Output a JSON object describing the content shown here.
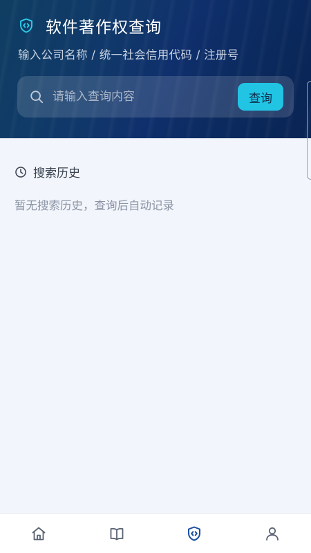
{
  "header": {
    "title": "软件著作权查询",
    "subtitle": "输入公司名称 / 统一社会信用代码 / 注册号",
    "logo_icon": "shield-code-icon"
  },
  "search": {
    "placeholder": "请输入查询内容",
    "value": "",
    "button_label": "查询"
  },
  "history": {
    "title": "搜索历史",
    "empty_text": "暂无搜索历史，查询后自动记录"
  },
  "tabbar": {
    "items": [
      {
        "icon": "home-icon",
        "active": false
      },
      {
        "icon": "book-icon",
        "active": false
      },
      {
        "icon": "shield-code-icon",
        "active": true
      },
      {
        "icon": "user-icon",
        "active": false
      }
    ]
  },
  "colors": {
    "header_dark": "#0b2a5e",
    "accent": "#22c4e4",
    "active_tab": "#1a4fa0",
    "inactive_tab": "#5a6372",
    "background": "#f2f5fb"
  }
}
